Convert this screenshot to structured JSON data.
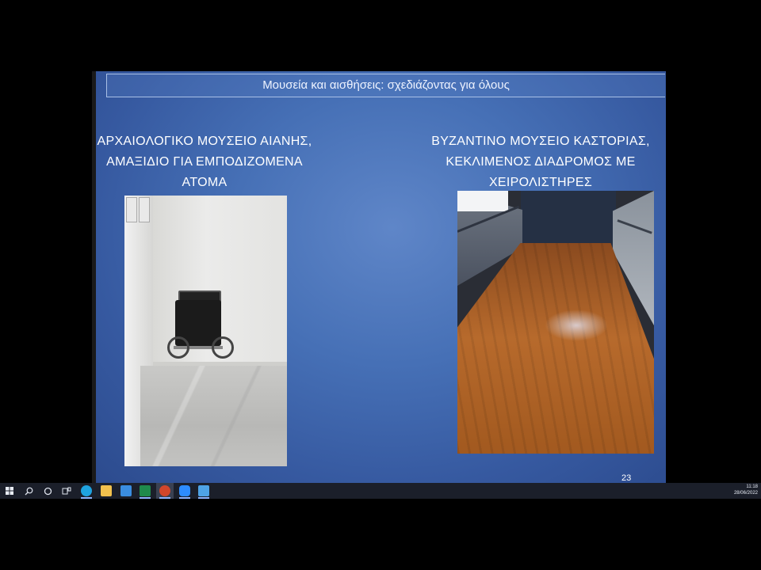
{
  "slide": {
    "title": "Μουσεία και αισθήσεις: σχεδιάζοντας για όλους",
    "left_caption": "ΑΡΧΑΙΟΛΟΓΙΚΟ ΜΟΥΣΕΙΟ ΑΙΑΝΗΣ, ΑΜΑΞΙΔΙΟ ΓΙΑ ΕΜΠΟΔΙΖΟΜΕΝΑ ΑΤΟΜΑ",
    "right_caption": "ΒΥΖΑΝΤΙΝΟ ΜΟΥΣΕΙΟ ΚΑΣΤΟΡΙΑΣ, ΚΕΚΛΙΜΕΝΟΣ ΔΙΑΔΡΟΜΟΣ ΜΕ ΧΕΙΡΟΛΙΣΤΗΡΕΣ",
    "page_number": "23"
  },
  "taskbar": {
    "icons": [
      "windows-start-icon",
      "search-icon",
      "cortana-icon",
      "task-view-icon",
      "edge-icon",
      "file-explorer-icon",
      "mail-icon",
      "excel-icon",
      "powerpoint-icon",
      "zoom-icon",
      "photos-icon"
    ],
    "time": "11:18",
    "date": "28/06/2022",
    "colors": {
      "edge": "#1fa3e0",
      "explorer": "#f2c14e",
      "mail": "#3a8de0",
      "excel": "#1f8a4c",
      "powerpoint": "#d2462b",
      "zoom": "#2d8cff",
      "photos": "#4ea3e6"
    }
  }
}
